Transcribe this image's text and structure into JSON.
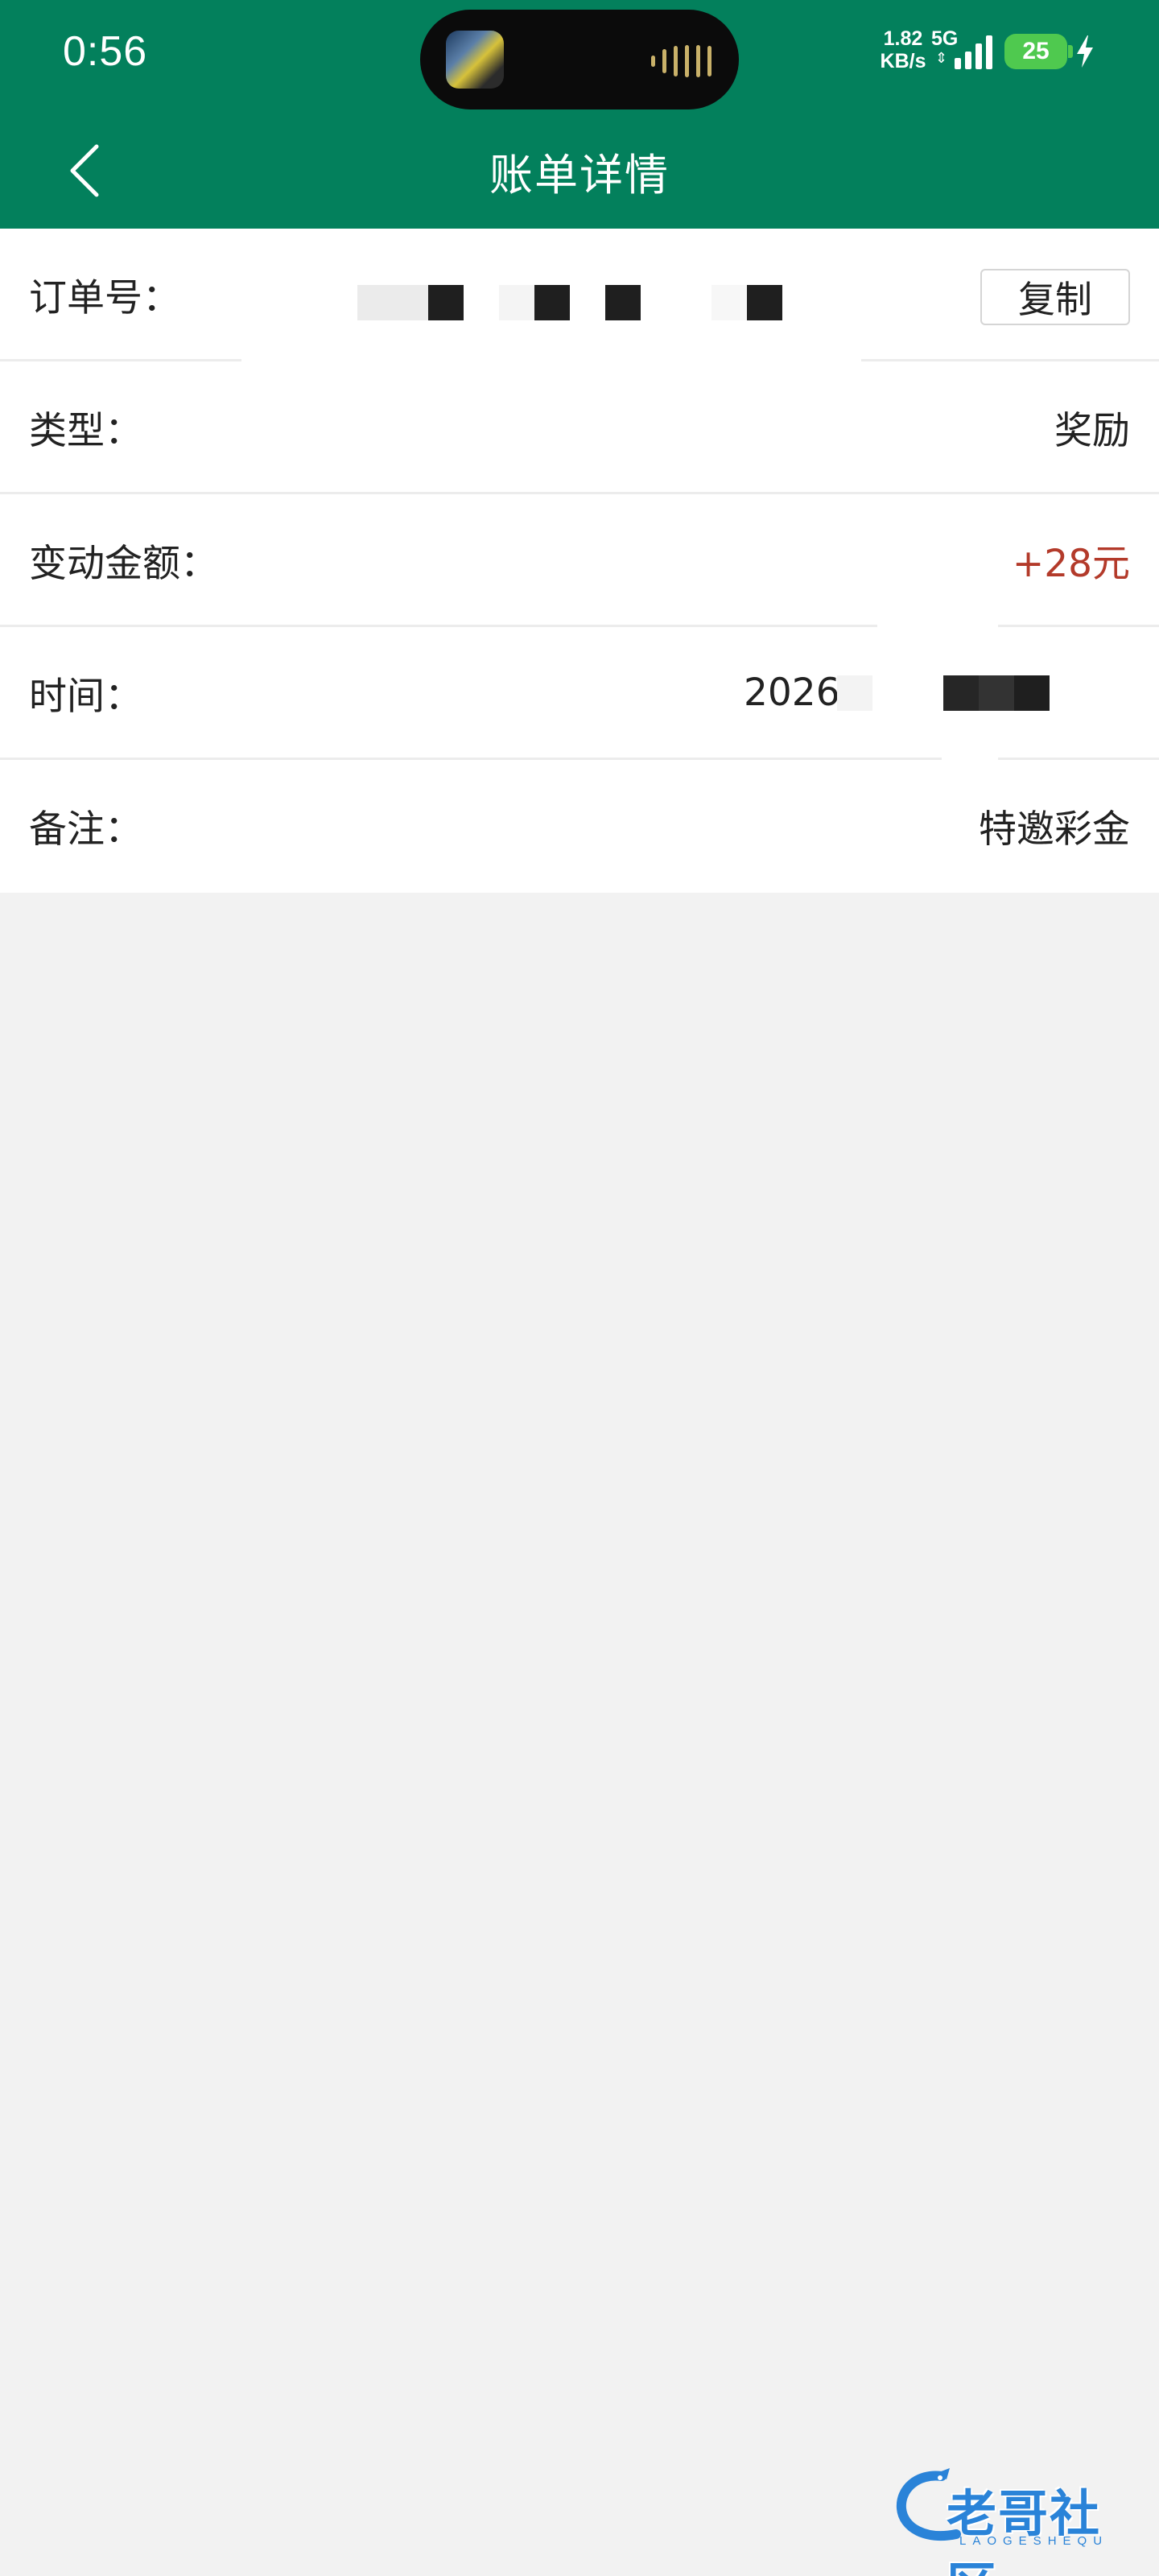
{
  "status_bar": {
    "time": "0:56",
    "net_speed_value": "1.82",
    "net_speed_unit": "KB/s",
    "network_type": "5G",
    "battery_level": "25",
    "signal_icon": "signal-bars-icon",
    "charging_icon": "lightning-icon",
    "accent": "#03805c"
  },
  "nav": {
    "back_icon": "chevron-left-icon",
    "title": "账单详情"
  },
  "details": {
    "order": {
      "label": "订单号：",
      "copy_label": "复制"
    },
    "type": {
      "label": "类型：",
      "value": "奖励"
    },
    "amount": {
      "label": "变动金额：",
      "value": "+28元",
      "color": "#b33a2a"
    },
    "time": {
      "label": "时间：",
      "value_visible": "2026"
    },
    "note": {
      "label": "备注：",
      "value": "特邀彩金"
    }
  },
  "watermark": {
    "text": "老哥社区",
    "subtext": "LAOGESHEQU"
  }
}
